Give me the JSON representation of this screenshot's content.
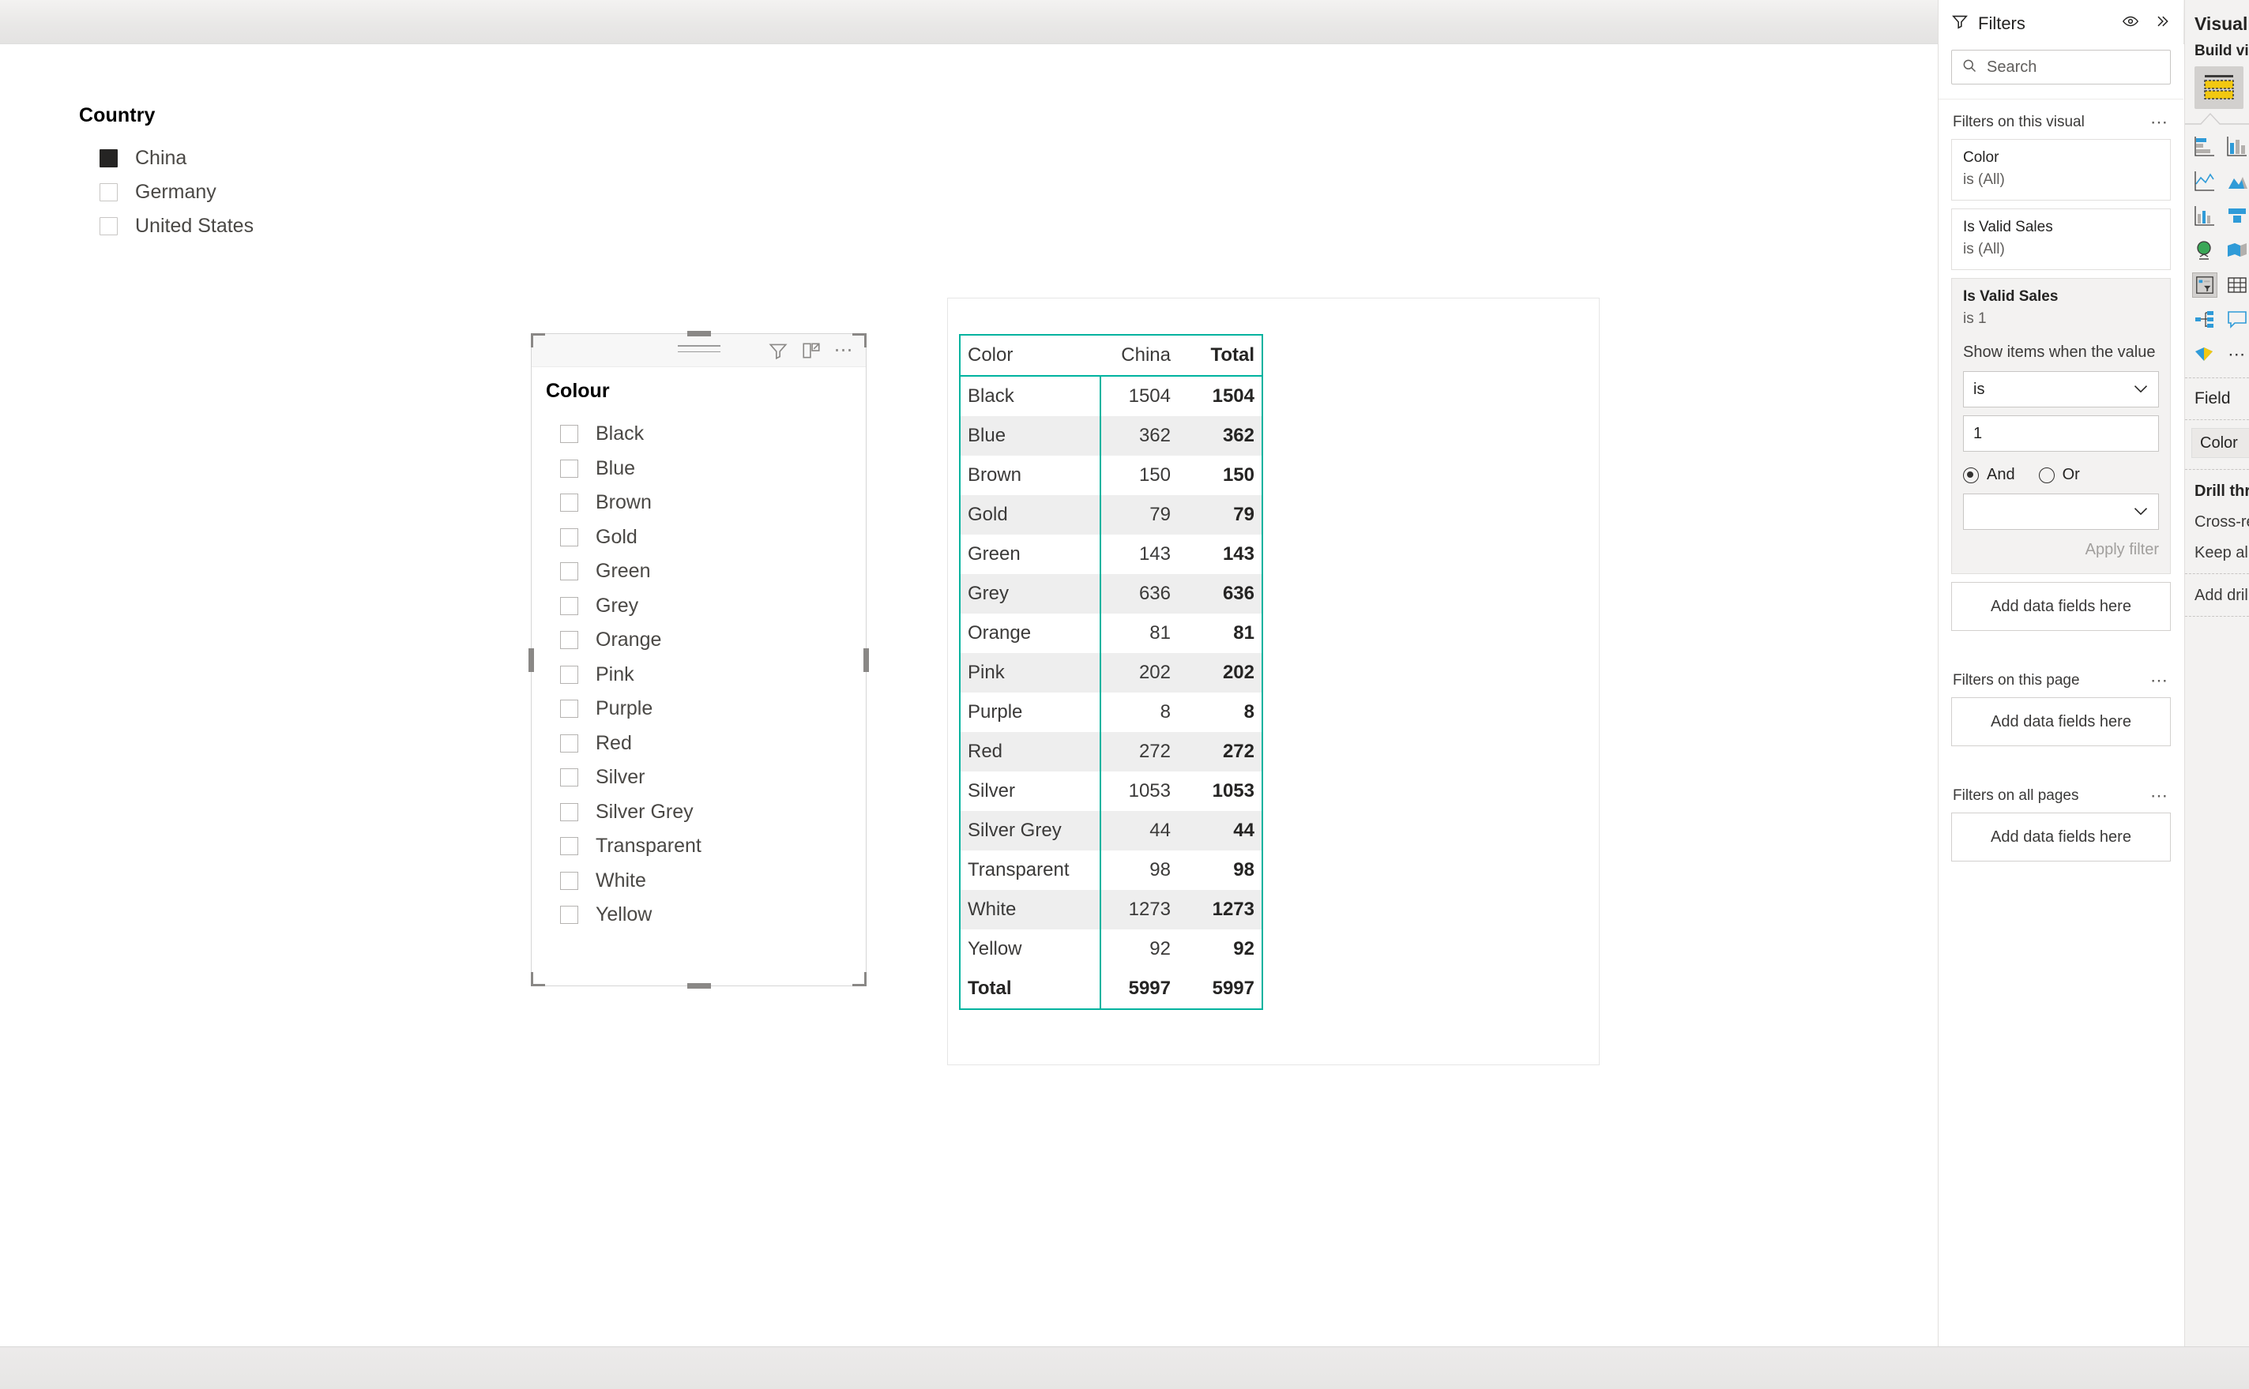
{
  "country_slicer": {
    "title": "Country",
    "items": [
      {
        "label": "China",
        "checked": true
      },
      {
        "label": "Germany",
        "checked": false
      },
      {
        "label": "United States",
        "checked": false
      }
    ]
  },
  "colour_slicer": {
    "title": "Colour",
    "header_icons": [
      "list-icon",
      "filter-icon",
      "focus-mode-icon",
      "more-options-icon"
    ],
    "items": [
      {
        "label": "Black",
        "checked": false
      },
      {
        "label": "Blue",
        "checked": false
      },
      {
        "label": "Brown",
        "checked": false
      },
      {
        "label": "Gold",
        "checked": false
      },
      {
        "label": "Green",
        "checked": false
      },
      {
        "label": "Grey",
        "checked": false
      },
      {
        "label": "Orange",
        "checked": false
      },
      {
        "label": "Pink",
        "checked": false
      },
      {
        "label": "Purple",
        "checked": false
      },
      {
        "label": "Red",
        "checked": false
      },
      {
        "label": "Silver",
        "checked": false
      },
      {
        "label": "Silver Grey",
        "checked": false
      },
      {
        "label": "Transparent",
        "checked": false
      },
      {
        "label": "White",
        "checked": false
      },
      {
        "label": "Yellow",
        "checked": false
      }
    ]
  },
  "matrix": {
    "selection_color": "#00b39f",
    "chart_data": {
      "type": "table",
      "title": "",
      "columns": [
        "Color",
        "China",
        "Total"
      ],
      "rows": [
        {
          "Color": "Black",
          "China": 1504,
          "Total": 1504
        },
        {
          "Color": "Blue",
          "China": 362,
          "Total": 362
        },
        {
          "Color": "Brown",
          "China": 150,
          "Total": 150
        },
        {
          "Color": "Gold",
          "China": 79,
          "Total": 79
        },
        {
          "Color": "Green",
          "China": 143,
          "Total": 143
        },
        {
          "Color": "Grey",
          "China": 636,
          "Total": 636
        },
        {
          "Color": "Orange",
          "China": 81,
          "Total": 81
        },
        {
          "Color": "Pink",
          "China": 202,
          "Total": 202
        },
        {
          "Color": "Purple",
          "China": 8,
          "Total": 8
        },
        {
          "Color": "Red",
          "China": 272,
          "Total": 272
        },
        {
          "Color": "Silver",
          "China": 1053,
          "Total": 1053
        },
        {
          "Color": "Silver Grey",
          "China": 44,
          "Total": 44
        },
        {
          "Color": "Transparent",
          "China": 98,
          "Total": 98
        },
        {
          "Color": "White",
          "China": 1273,
          "Total": 1273
        },
        {
          "Color": "Yellow",
          "China": 92,
          "Total": 92
        }
      ],
      "total_row": {
        "Color": "Total",
        "China": 5997,
        "Total": 5997
      }
    }
  },
  "filters_pane": {
    "title": "Filters",
    "header_icons": [
      "eye-icon",
      "double-chevron-right-icon"
    ],
    "search_placeholder": "Search",
    "sections": [
      {
        "title": "Filters on this visual",
        "cards": [
          {
            "name": "Color",
            "state": "is (All)",
            "expanded": false
          },
          {
            "name": "Is Valid Sales",
            "state": "is (All)",
            "expanded": false
          },
          {
            "name": "Is Valid Sales",
            "state": "is 1",
            "expanded": true,
            "sub_label": "Show items when the value",
            "operator": "is",
            "value": "1",
            "radio_and": "And",
            "radio_or": "Or",
            "selected_radio": "And",
            "second_operator": "",
            "apply_label": "Apply filter"
          }
        ],
        "dropzone": "Add data fields here"
      },
      {
        "title": "Filters on this page",
        "cards": [],
        "dropzone": "Add data fields here"
      },
      {
        "title": "Filters on all pages",
        "cards": [],
        "dropzone": "Add data fields here"
      }
    ]
  },
  "visualizations_pane": {
    "title": "Visualiz",
    "subtitle": "Build visu",
    "selected_visual_icon": "matrix-icon",
    "gallery": [
      [
        "stacked-bar-chart-icon",
        "stacked-column-chart-icon"
      ],
      [
        "line-chart-icon",
        "area-chart-icon"
      ],
      [
        "combo-chart-icon",
        "ribbon-chart-icon"
      ],
      [
        "globe-map-icon",
        "filled-map-icon"
      ],
      [
        "slicer-icon",
        "table-icon"
      ],
      [
        "decomposition-tree-icon",
        "card-icon"
      ],
      [
        "kpi-icon",
        "more-visuals-icon"
      ]
    ],
    "field_section_title": "Field",
    "field_chip": "Color",
    "drill_through_label": "Drill thro",
    "cross_report_label": "Cross-rep",
    "keep_all_filters_label": "Keep all f",
    "add_drill_label": "Add drill-"
  }
}
